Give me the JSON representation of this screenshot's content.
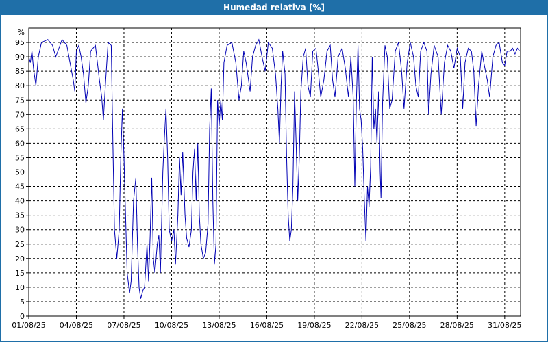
{
  "window": {
    "title": "Humedad relativa [%]"
  },
  "chart_data": {
    "type": "line",
    "title": "Humedad relativa [%]",
    "ylabel": "%",
    "xlabel": "",
    "ylim": [
      0,
      100
    ],
    "yticks": [
      0,
      5,
      10,
      15,
      20,
      25,
      30,
      35,
      40,
      45,
      50,
      55,
      60,
      65,
      70,
      75,
      80,
      85,
      90,
      95
    ],
    "xlim": [
      1,
      32
    ],
    "xticks": [
      {
        "day": 1,
        "label": "01/08/25"
      },
      {
        "day": 4,
        "label": "04/08/25"
      },
      {
        "day": 7,
        "label": "07/08/25"
      },
      {
        "day": 10,
        "label": "10/08/25"
      },
      {
        "day": 13,
        "label": "13/08/25"
      },
      {
        "day": 16,
        "label": "16/08/25"
      },
      {
        "day": 19,
        "label": "19/08/25"
      },
      {
        "day": 22,
        "label": "22/08/25"
      },
      {
        "day": 25,
        "label": "25/08/25"
      },
      {
        "day": 28,
        "label": "28/08/25"
      },
      {
        "day": 31,
        "label": "31/08/25"
      }
    ],
    "grid": true,
    "grid_style": "dashed",
    "line_color": "#0000b4",
    "series": [
      {
        "values": [
          [
            1.0,
            90
          ],
          [
            1.1,
            88
          ],
          [
            1.2,
            92
          ],
          [
            1.3,
            86
          ],
          [
            1.45,
            80
          ],
          [
            1.6,
            90
          ],
          [
            1.8,
            95
          ],
          [
            2.2,
            96
          ],
          [
            2.5,
            94
          ],
          [
            2.7,
            90
          ],
          [
            2.9,
            93
          ],
          [
            3.1,
            96
          ],
          [
            3.4,
            94
          ],
          [
            3.6,
            88
          ],
          [
            3.8,
            82
          ],
          [
            3.9,
            78
          ],
          [
            4.0,
            92
          ],
          [
            4.15,
            94
          ],
          [
            4.3,
            90
          ],
          [
            4.45,
            84
          ],
          [
            4.6,
            74
          ],
          [
            4.75,
            80
          ],
          [
            4.9,
            92
          ],
          [
            5.2,
            94
          ],
          [
            5.45,
            82
          ],
          [
            5.6,
            76
          ],
          [
            5.7,
            68
          ],
          [
            5.85,
            82
          ],
          [
            6.0,
            95
          ],
          [
            6.2,
            94
          ],
          [
            6.3,
            60
          ],
          [
            6.4,
            30
          ],
          [
            6.55,
            20
          ],
          [
            6.7,
            30
          ],
          [
            6.8,
            55
          ],
          [
            6.9,
            72
          ],
          [
            7.0,
            55
          ],
          [
            7.1,
            35
          ],
          [
            7.2,
            15
          ],
          [
            7.35,
            8
          ],
          [
            7.45,
            12
          ],
          [
            7.6,
            40
          ],
          [
            7.75,
            48
          ],
          [
            7.85,
            25
          ],
          [
            7.95,
            10
          ],
          [
            8.05,
            6
          ],
          [
            8.2,
            9
          ],
          [
            8.3,
            10
          ],
          [
            8.45,
            25
          ],
          [
            8.55,
            12
          ],
          [
            8.65,
            28
          ],
          [
            8.75,
            48
          ],
          [
            8.85,
            20
          ],
          [
            8.95,
            15
          ],
          [
            9.1,
            25
          ],
          [
            9.2,
            28
          ],
          [
            9.3,
            15
          ],
          [
            9.45,
            50
          ],
          [
            9.55,
            62
          ],
          [
            9.65,
            72
          ],
          [
            9.75,
            55
          ],
          [
            9.85,
            30
          ],
          [
            10.0,
            26
          ],
          [
            10.15,
            30
          ],
          [
            10.25,
            18
          ],
          [
            10.4,
            35
          ],
          [
            10.5,
            55
          ],
          [
            10.6,
            42
          ],
          [
            10.7,
            57
          ],
          [
            10.85,
            35
          ],
          [
            10.95,
            27
          ],
          [
            11.1,
            24
          ],
          [
            11.25,
            30
          ],
          [
            11.35,
            50
          ],
          [
            11.45,
            58
          ],
          [
            11.55,
            40
          ],
          [
            11.65,
            60
          ],
          [
            11.75,
            35
          ],
          [
            11.85,
            25
          ],
          [
            12.0,
            20
          ],
          [
            12.15,
            22
          ],
          [
            12.3,
            32
          ],
          [
            12.4,
            65
          ],
          [
            12.5,
            79
          ],
          [
            12.6,
            40
          ],
          [
            12.7,
            18
          ],
          [
            12.8,
            25
          ],
          [
            12.9,
            75
          ],
          [
            13.0,
            66
          ],
          [
            13.1,
            75
          ],
          [
            13.2,
            68
          ],
          [
            13.3,
            88
          ],
          [
            13.5,
            94
          ],
          [
            13.8,
            95
          ],
          [
            14.05,
            88
          ],
          [
            14.25,
            75
          ],
          [
            14.4,
            80
          ],
          [
            14.55,
            92
          ],
          [
            14.7,
            88
          ],
          [
            14.85,
            82
          ],
          [
            14.95,
            78
          ],
          [
            15.1,
            90
          ],
          [
            15.3,
            94
          ],
          [
            15.5,
            96
          ],
          [
            15.7,
            90
          ],
          [
            15.9,
            85
          ],
          [
            16.1,
            95
          ],
          [
            16.35,
            93
          ],
          [
            16.55,
            84
          ],
          [
            16.7,
            72
          ],
          [
            16.8,
            60
          ],
          [
            16.9,
            80
          ],
          [
            17.0,
            92
          ],
          [
            17.15,
            84
          ],
          [
            17.25,
            55
          ],
          [
            17.35,
            35
          ],
          [
            17.45,
            26
          ],
          [
            17.55,
            30
          ],
          [
            17.65,
            45
          ],
          [
            17.75,
            78
          ],
          [
            17.85,
            60
          ],
          [
            17.95,
            40
          ],
          [
            18.05,
            55
          ],
          [
            18.15,
            78
          ],
          [
            18.3,
            90
          ],
          [
            18.45,
            93
          ],
          [
            18.6,
            80
          ],
          [
            18.75,
            76
          ],
          [
            18.9,
            92
          ],
          [
            19.1,
            93
          ],
          [
            19.25,
            85
          ],
          [
            19.4,
            76
          ],
          [
            19.6,
            82
          ],
          [
            19.8,
            92
          ],
          [
            20.0,
            94
          ],
          [
            20.15,
            82
          ],
          [
            20.3,
            76
          ],
          [
            20.5,
            90
          ],
          [
            20.75,
            93
          ],
          [
            20.95,
            86
          ],
          [
            21.15,
            76
          ],
          [
            21.3,
            90
          ],
          [
            21.45,
            76
          ],
          [
            21.55,
            45
          ],
          [
            21.65,
            75
          ],
          [
            21.75,
            94
          ],
          [
            21.85,
            72
          ],
          [
            21.95,
            68
          ],
          [
            22.05,
            58
          ],
          [
            22.15,
            40
          ],
          [
            22.25,
            26
          ],
          [
            22.35,
            45
          ],
          [
            22.45,
            38
          ],
          [
            22.55,
            52
          ],
          [
            22.65,
            90
          ],
          [
            22.75,
            65
          ],
          [
            22.85,
            72
          ],
          [
            22.95,
            60
          ],
          [
            23.05,
            78
          ],
          [
            23.15,
            50
          ],
          [
            23.2,
            41
          ],
          [
            23.3,
            74
          ],
          [
            23.45,
            94
          ],
          [
            23.6,
            90
          ],
          [
            23.75,
            72
          ],
          [
            23.9,
            75
          ],
          [
            24.1,
            92
          ],
          [
            24.3,
            95
          ],
          [
            24.5,
            85
          ],
          [
            24.65,
            72
          ],
          [
            24.85,
            88
          ],
          [
            25.05,
            95
          ],
          [
            25.25,
            90
          ],
          [
            25.4,
            80
          ],
          [
            25.55,
            76
          ],
          [
            25.7,
            92
          ],
          [
            25.9,
            95
          ],
          [
            26.1,
            92
          ],
          [
            26.2,
            70
          ],
          [
            26.35,
            84
          ],
          [
            26.55,
            94
          ],
          [
            26.8,
            90
          ],
          [
            27.0,
            70
          ],
          [
            27.2,
            88
          ],
          [
            27.4,
            94
          ],
          [
            27.6,
            92
          ],
          [
            27.8,
            86
          ],
          [
            28.0,
            93
          ],
          [
            28.2,
            90
          ],
          [
            28.35,
            72
          ],
          [
            28.5,
            88
          ],
          [
            28.7,
            93
          ],
          [
            28.9,
            92
          ],
          [
            29.05,
            85
          ],
          [
            29.2,
            66
          ],
          [
            29.35,
            80
          ],
          [
            29.55,
            92
          ],
          [
            29.75,
            86
          ],
          [
            29.9,
            82
          ],
          [
            30.05,
            76
          ],
          [
            30.25,
            90
          ],
          [
            30.45,
            94
          ],
          [
            30.65,
            95
          ],
          [
            30.85,
            88
          ],
          [
            31.0,
            87
          ],
          [
            31.15,
            92
          ],
          [
            31.35,
            92
          ],
          [
            31.5,
            93
          ],
          [
            31.65,
            91
          ],
          [
            31.8,
            93
          ],
          [
            31.95,
            92
          ]
        ]
      }
    ]
  }
}
